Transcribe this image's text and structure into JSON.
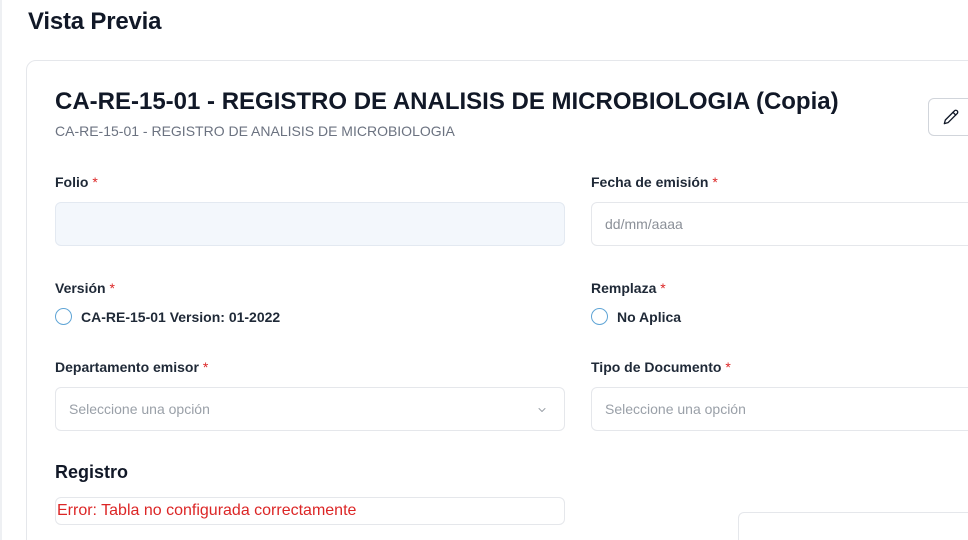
{
  "page": {
    "title": "Vista Previa"
  },
  "document": {
    "title": "CA-RE-15-01 - REGISTRO DE ANALISIS DE MICROBIOLOGIA (Copia)",
    "subtitle": "CA-RE-15-01 - REGISTRO DE ANALISIS DE MICROBIOLOGIA"
  },
  "form": {
    "required_marker": "*",
    "folio": {
      "label": "Folio",
      "value": "",
      "placeholder": ""
    },
    "fecha_emision": {
      "label": "Fecha de emisión",
      "value": "",
      "placeholder": "dd/mm/aaaa"
    },
    "version": {
      "label": "Versión",
      "option": "CA-RE-15-01 Version: 01-2022"
    },
    "remplaza": {
      "label": "Remplaza",
      "option": "No Aplica"
    },
    "departamento_emisor": {
      "label": "Departamento emisor",
      "placeholder": "Seleccione una opción"
    },
    "tipo_documento": {
      "label": "Tipo de Documento",
      "placeholder": "Seleccione una opción"
    }
  },
  "registro": {
    "title": "Registro",
    "error": "Error: Tabla no configurada correctamente"
  },
  "icons": {
    "edit": "pencil-icon",
    "dropdown": "chevron-down-icon"
  },
  "colors": {
    "required": "#dc2626",
    "error": "#dc2626",
    "radio_border": "#60a5d6",
    "folio_bg": "#f3f7fc"
  }
}
